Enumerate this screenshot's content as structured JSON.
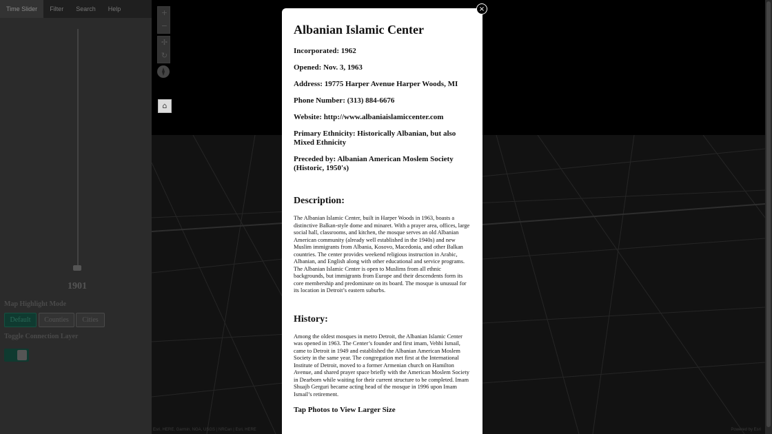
{
  "sidebar": {
    "tabs": [
      {
        "label": "Time Slider"
      },
      {
        "label": "Filter"
      },
      {
        "label": "Search"
      },
      {
        "label": "Help"
      }
    ],
    "year": "1901",
    "highlight_heading": "Map Highlight Mode",
    "mode_buttons": [
      {
        "label": "Default"
      },
      {
        "label": "Counties"
      },
      {
        "label": "Cities"
      }
    ],
    "connection_heading": "Toggle Connection Layer"
  },
  "map": {
    "controls": {
      "zoom_in": "+",
      "zoom_out": "−",
      "pan": "✢",
      "rotate": "↻",
      "home": "⌂"
    },
    "attribution": "Esri, HERE, Garmin, NGA, USGS | NRCan | Esri, HERE",
    "powered": "Powered by Esri"
  },
  "modal": {
    "close": "×",
    "title": "Albanian Islamic Center",
    "facts": [
      {
        "text": "Incorporated: 1962"
      },
      {
        "text": "Opened: Nov. 3, 1963"
      },
      {
        "text": "Address: 19775 Harper Avenue Harper Woods, MI"
      },
      {
        "text": "Phone Number: (313) 884-6676"
      },
      {
        "text": "Website: http://www.albaniaislamiccenter.com"
      },
      {
        "text": "Primary Ethnicity: Historically Albanian, but also Mixed Ethnicity"
      },
      {
        "text": "Preceded by: Albanian American Moslem Society (Historic, 1950's)"
      }
    ],
    "description_heading": "Description:",
    "description": "The Albanian Islamic Center, built in Harper Woods in 1963, boasts a distinctive Balkan-style dome and minaret. With a prayer area, offices, large social hall, classrooms, and kitchen, the mosque serves an old Albanian American community (already well established in the 1940s) and new Muslim immigrants from Albania, Kosovo, Macedonia, and other Balkan countries. The center provides weekend religious instruction in Arabic, Albanian, and English along with other educational and service programs. The Albanian Islamic Center is open to Muslims from all ethnic backgrounds, but immigrants from Europe and their descendents form its core membership and predominate on its board. The mosque is unusual for its location in Detroit’s eastern suburbs.",
    "history_heading": "History:",
    "history": "Among the oldest mosques in metro Detroit, the Albanian Islamic Center was opened in 1963. The Center’s founder and first imam, Vehbi Ismail, came to Detroit in 1949 and established the Albanian American Moslem Society in the same year. The congregation met first at the International Institute of Detroit, moved to a former Armenian church on Hamilton Avenue, and shared prayer space briefly with the American Moslem Society in Dearborn while waiting for their current structure to be completed. Imam Shuajb Gerguri became acting head of the mosque in 1996 upon Imam Ismail’s retirement.",
    "photos_heading": "Tap Photos to View Larger Size"
  }
}
